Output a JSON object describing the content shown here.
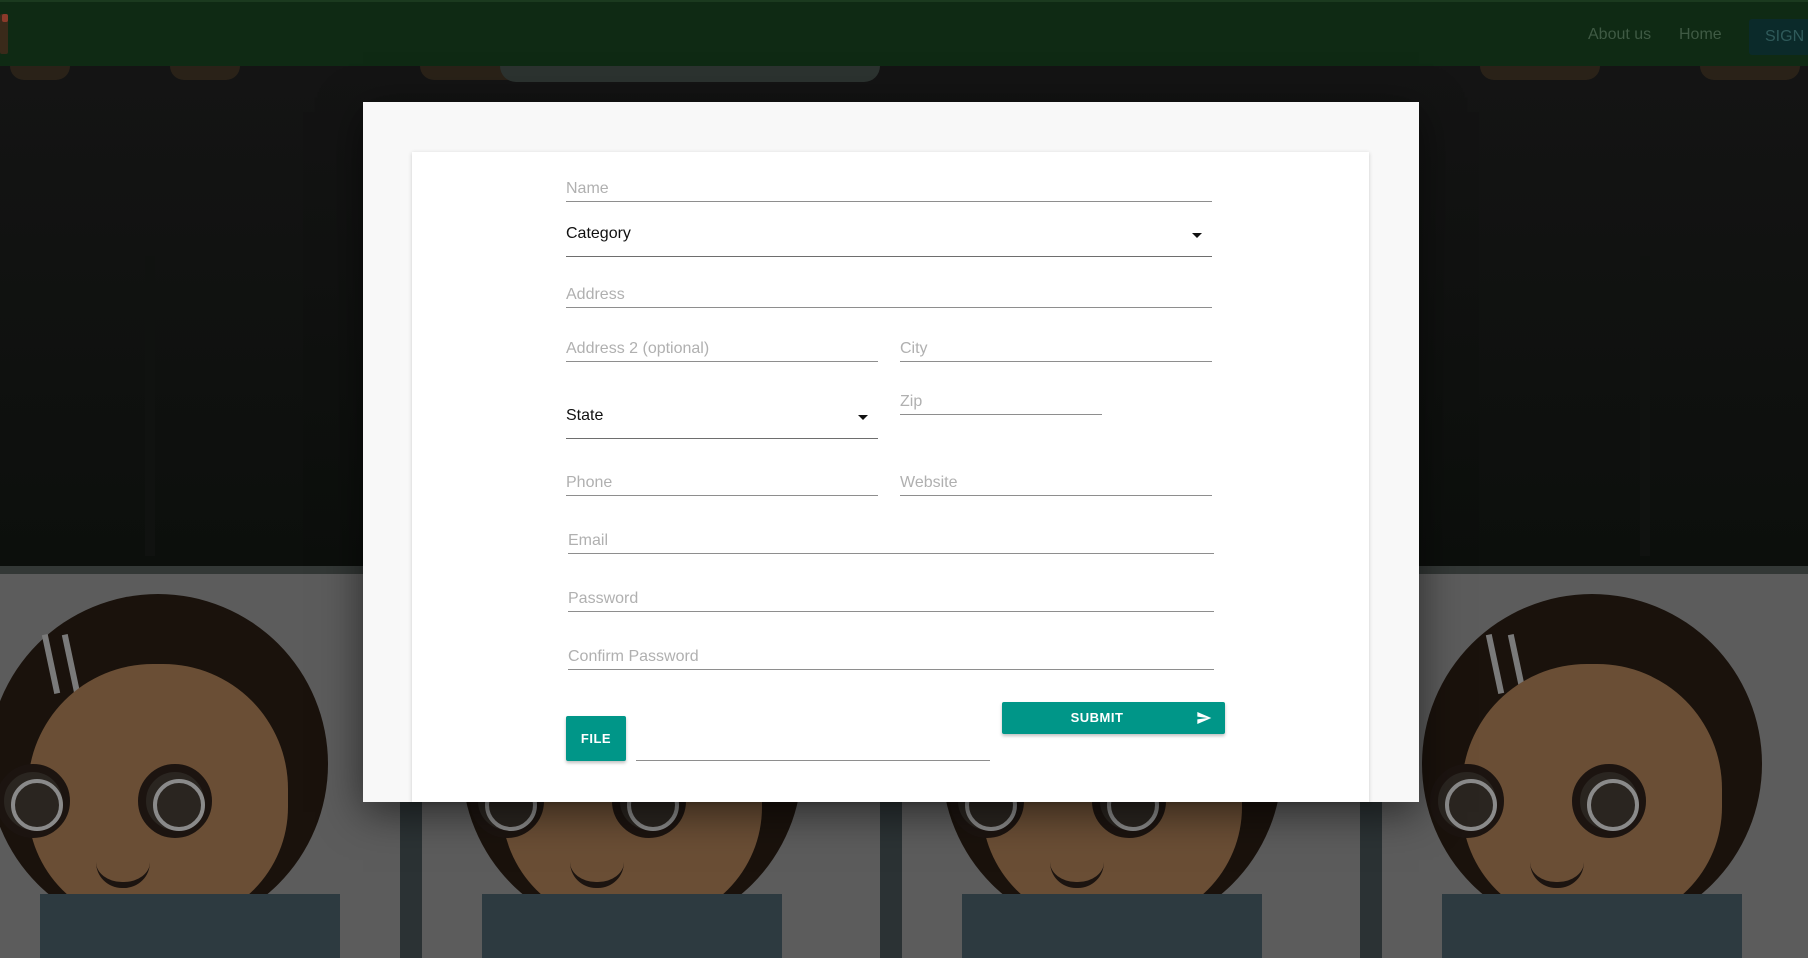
{
  "nav": {
    "about_label": "About us",
    "home_label": "Home",
    "signin_label": "SIGN I"
  },
  "form": {
    "name_placeholder": "Name",
    "category_label": "Category",
    "address_placeholder": "Address",
    "address2_placeholder": "Address 2 (optional)",
    "city_placeholder": "City",
    "state_label": "State",
    "zip_placeholder": "Zip",
    "phone_placeholder": "Phone",
    "website_placeholder": "Website",
    "email_placeholder": "Email",
    "password_placeholder": "Password",
    "confirm_password_placeholder": "Confirm Password",
    "file_button_label": "FILE",
    "submit_button_label": "SUBMIT"
  },
  "colors": {
    "accent": "#009688",
    "navbar": "#0f2a14"
  },
  "icons": {
    "select_caret": "caret-down-icon",
    "submit": "send-icon"
  }
}
